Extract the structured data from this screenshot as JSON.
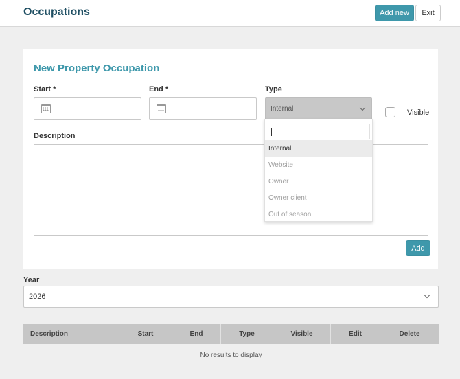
{
  "header": {
    "title": "Occupations",
    "add_new_label": "Add new",
    "exit_label": "Exit"
  },
  "form": {
    "title": "New Property Occupation",
    "start_label": "Start *",
    "end_label": "End *",
    "type_label": "Type",
    "type_selected": "Internal",
    "visible_label": "Visible",
    "visible_checked": false,
    "description_label": "Description",
    "add_label": "Add"
  },
  "type_dropdown": {
    "options": [
      "Internal",
      "Website",
      "Owner",
      "Owner client",
      "Out of season"
    ],
    "highlighted": "Internal"
  },
  "year": {
    "label": "Year",
    "selected": "2026"
  },
  "table": {
    "columns": [
      "Description",
      "Start",
      "End",
      "Type",
      "Visible",
      "Edit",
      "Delete"
    ],
    "empty_text": "No results to display"
  },
  "colors": {
    "accent": "#3e98ab",
    "title": "#1f4f63",
    "header_row": "#c6c6c6"
  },
  "icons": {
    "date_picker": "calendar-icon",
    "select_arrow": "chevron-down-icon"
  }
}
